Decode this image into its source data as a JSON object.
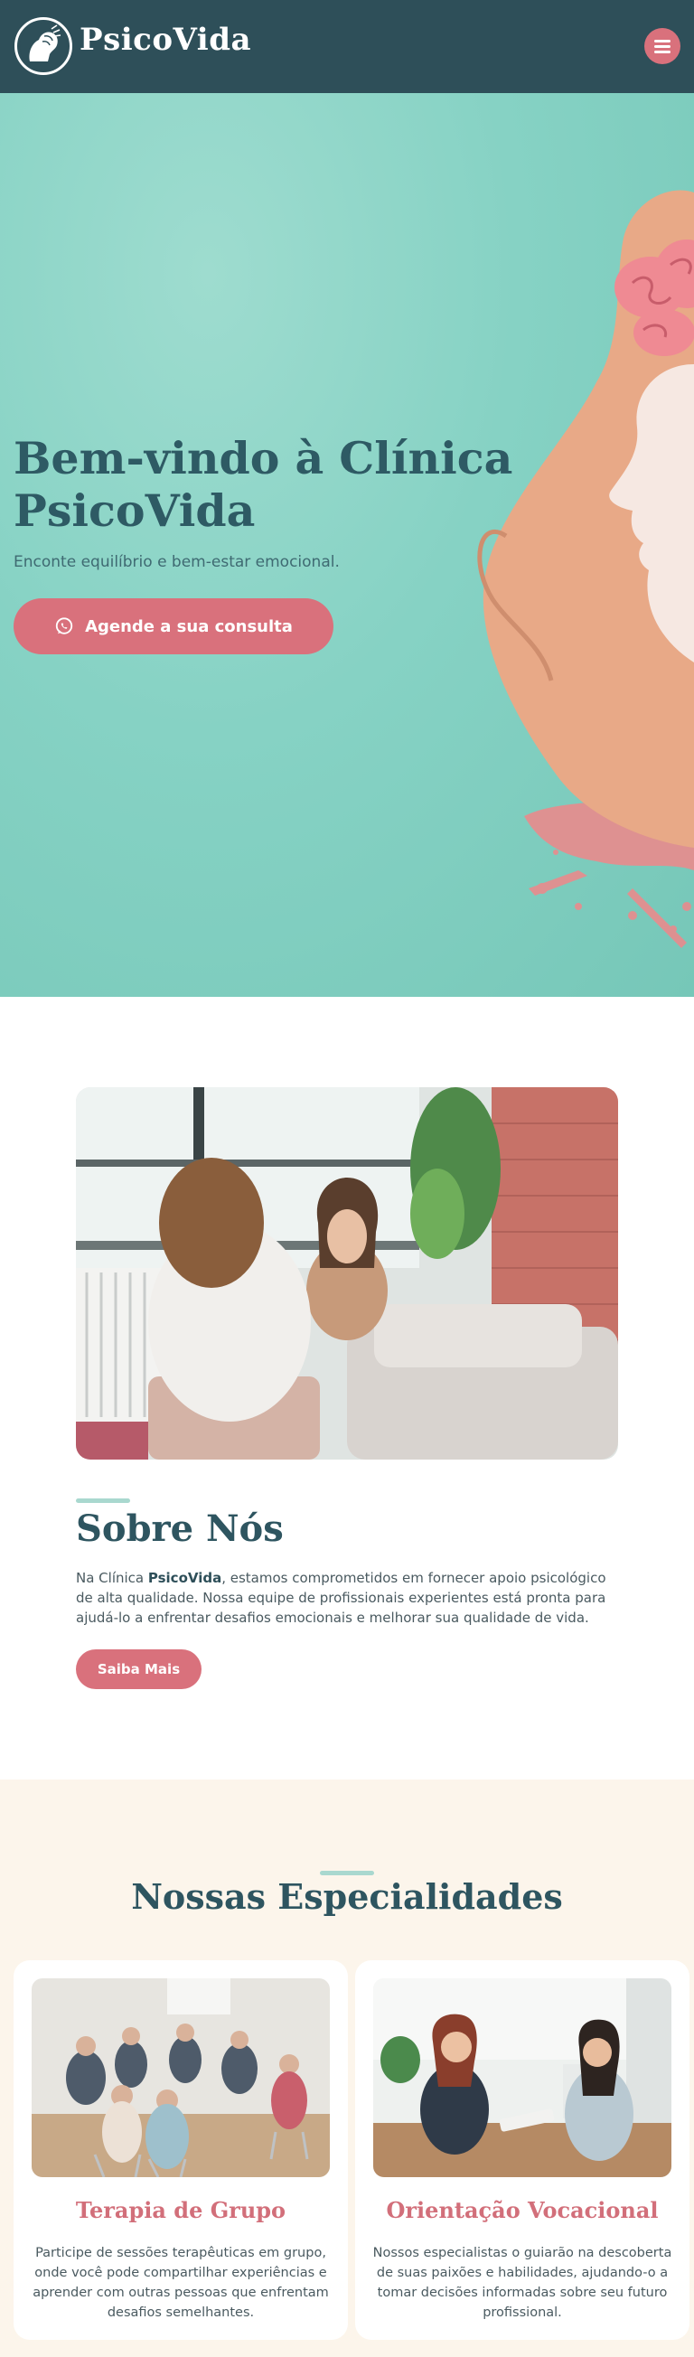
{
  "header": {
    "brand": "PsicoVida",
    "menu_icon": "hamburger-menu-icon"
  },
  "hero": {
    "title": "Bem-vindo à Clínica PsicoVida",
    "subtitle": "Enconte equilíbrio e bem-estar emocional.",
    "cta_label": "Agende a sua consulta",
    "cta_icon": "whatsapp-icon"
  },
  "about": {
    "title": "Sobre Nós",
    "text_prefix": "Na Clínica ",
    "text_brand": "PsicoVida",
    "text_suffix": ", estamos comprometidos em fornecer apoio psicológico de alta qualidade. Nossa equipe de profissionais experientes está pronta para ajudá-lo a enfrentar desafios emocionais e melhorar sua qualidade de vida.",
    "button_label": "Saiba Mais"
  },
  "specialties": {
    "title": "Nossas Especialidades",
    "cards": [
      {
        "title": "Terapia de Grupo",
        "text": "Participe de sessões terapêuticas em grupo, onde você pode compartilhar experiências e aprender com outras pessoas que enfrentam desafios semelhantes."
      },
      {
        "title": "Orientação Vocacional",
        "text": "Nossos especialistas o guiarão na descoberta de suas paixões e habilidades, ajudando-o a tomar decisões informadas sobre seu futuro profissional."
      }
    ]
  },
  "colors": {
    "header_bg": "#2e4f59",
    "accent": "#d9717c",
    "hero_bg": "#86d2c4",
    "section_bg": "#fcf5eb"
  }
}
